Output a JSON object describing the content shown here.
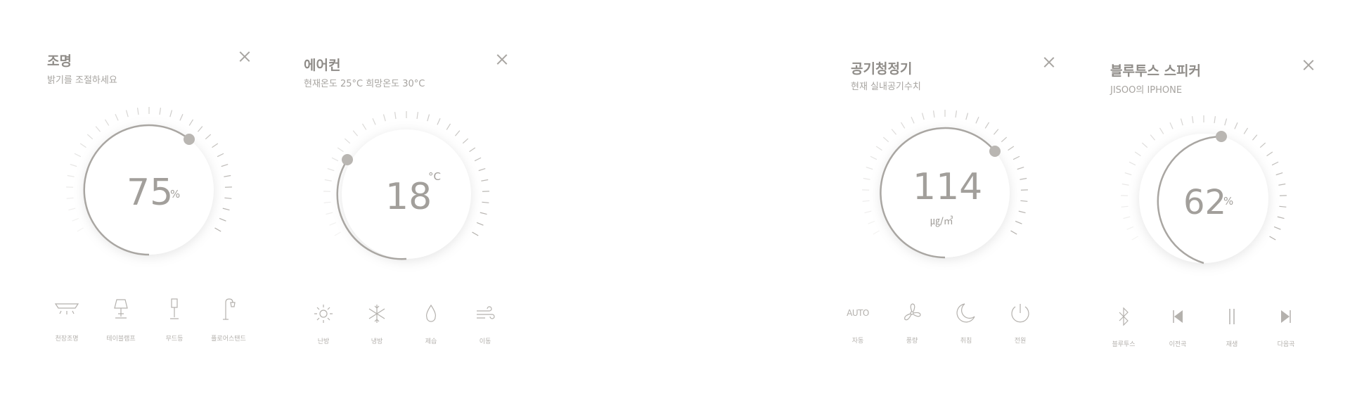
{
  "colors": {
    "ink": "#a9a6a2",
    "track": "#ebe9e6",
    "knob": "#b9b6b2",
    "tick": "#c9c6c2"
  },
  "lighting": {
    "title": "조명",
    "subtitle": "밝기를 조절하세요",
    "value": "75",
    "unit": "%",
    "level_percent": 75,
    "options": [
      {
        "label": "천장조명",
        "icon": "ceiling-light-icon"
      },
      {
        "label": "테이블램프",
        "icon": "table-lamp-icon"
      },
      {
        "label": "무드등",
        "icon": "mood-lamp-icon"
      },
      {
        "label": "플로어스탠드",
        "icon": "floor-stand-icon"
      }
    ]
  },
  "aircon": {
    "title": "에어컨",
    "subtitle": "현재온도 25°C  희망온도 30°C",
    "value": "18",
    "unit": "°C",
    "options": [
      {
        "label": "난방",
        "icon": "sun-icon"
      },
      {
        "label": "냉방",
        "icon": "snowflake-icon"
      },
      {
        "label": "제습",
        "icon": "droplet-icon"
      },
      {
        "label": "이동",
        "icon": "wind-icon"
      }
    ]
  },
  "purifier": {
    "title": "공기청정기",
    "subtitle": "현재 실내공기수치",
    "value": "114",
    "unit": "㎍/㎥",
    "options": [
      {
        "label": "자동",
        "icon": "auto-icon",
        "glyph": "AUTO"
      },
      {
        "label": "풍량",
        "icon": "fan-icon"
      },
      {
        "label": "취침",
        "icon": "moon-icon"
      },
      {
        "label": "전원",
        "icon": "power-icon"
      }
    ]
  },
  "speaker": {
    "title": "블루투스 스피커",
    "subtitle": "JISOO의 IPHONE",
    "value": "62",
    "unit": "%",
    "level_percent": 62,
    "options": [
      {
        "label": "블루투스",
        "icon": "bluetooth-icon"
      },
      {
        "label": "이전곡",
        "icon": "previous-track-icon"
      },
      {
        "label": "재생",
        "icon": "pause-icon"
      },
      {
        "label": "다음곡",
        "icon": "next-track-icon"
      }
    ]
  }
}
